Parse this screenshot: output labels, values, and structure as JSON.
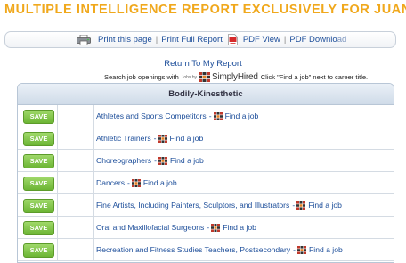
{
  "header": {
    "title": "MULTIPLE INTELLIGENCE REPORT EXCLUSIVELY FOR JUAN"
  },
  "toolbar": {
    "print_page": "Print this page",
    "print_full": "Print Full Report",
    "pdf_view": "PDF View",
    "pdf_download": "PDF Downlo",
    "pdf_download_faded": "ad",
    "separator": "|"
  },
  "nav": {
    "return_link": "Return To My Report"
  },
  "search": {
    "text_before": "Search job openings with",
    "jobs_by": "Jobs by",
    "brand": "SimplyHired",
    "text_after": "Click \"Find a job\" next to career title."
  },
  "table": {
    "header": "Bodily-Kinesthetic",
    "save_label": "SAVE",
    "find_label": "Find a job",
    "dash": "-",
    "rows": [
      {
        "career": "Athletes and Sports Competitors"
      },
      {
        "career": "Athletic Trainers"
      },
      {
        "career": "Choreographers"
      },
      {
        "career": "Dancers"
      },
      {
        "career": "Fine Artists, Including Painters, Sculptors, and Illustrators"
      },
      {
        "career": "Oral and Maxillofacial Surgeons"
      },
      {
        "career": "Recreation and Fitness Studies Teachers, Postsecondary"
      }
    ]
  },
  "colors": {
    "title": "#f0a81c",
    "link": "#1d4e9a",
    "save_button": "#7cc242",
    "table_header": "#d9e3ee"
  },
  "icons": {
    "printer": "printer-icon",
    "pdf": "pdf-icon",
    "simplyhired": "simplyhired-logo-icon"
  }
}
